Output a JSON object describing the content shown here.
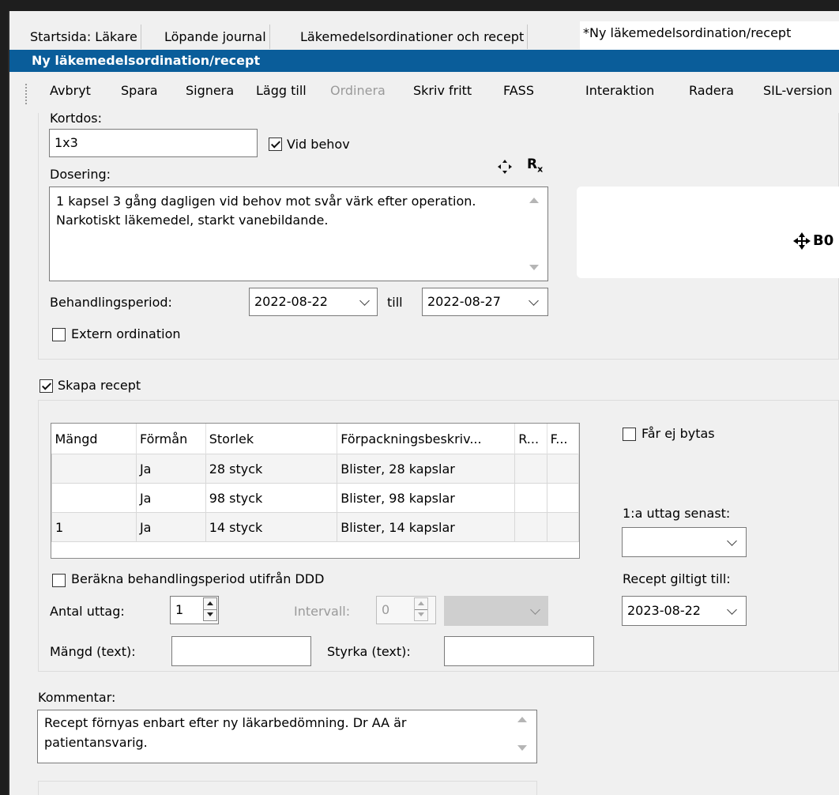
{
  "tabs": [
    {
      "label": "Startsida: Läkare"
    },
    {
      "label": "Löpande journal"
    },
    {
      "label": "Läkemedelsordinationer och recept"
    },
    {
      "label": "*Ny läkemedelsordination/recept"
    }
  ],
  "window_title": "Ny läkemedelsordination/recept",
  "toolbar": {
    "avbryt": "Avbryt",
    "spara": "Spara",
    "signera": "Signera",
    "lagg_till": "Lägg till",
    "ordinera": "Ordinera",
    "skriv_fritt": "Skriv fritt",
    "fass": "FASS",
    "interaktion": "Interaktion",
    "radera": "Radera",
    "sil_version": "SIL-version"
  },
  "kortdos": {
    "label": "Kortdos:",
    "value": "1x3"
  },
  "vid_behov": {
    "label": "Vid behov",
    "checked": true
  },
  "dosering": {
    "label": "Dosering:",
    "text": "1 kapsel 3 gång dagligen vid behov mot svår värk efter operation. Narkotiskt läkemedel, starkt vanebildande.",
    "move_icon": "move-arrows-icon",
    "rx_icon": "rx-icon"
  },
  "side_panel": {
    "text": "B0"
  },
  "behandlingsperiod": {
    "label": "Behandlingsperiod:",
    "from": "2022-08-22",
    "till_label": "till",
    "to": "2022-08-27"
  },
  "extern_ordination": {
    "label": "Extern ordination",
    "checked": false
  },
  "skapa_recept": {
    "label": "Skapa recept",
    "checked": true
  },
  "package_table": {
    "columns": [
      "Mängd",
      "Förmån",
      "Storlek",
      "Förpackningsbeskriv...",
      "R...",
      "F..."
    ],
    "rows": [
      {
        "mangd": "",
        "forman": "Ja",
        "storlek": "28 styck",
        "beskrivning": "Blister, 28 kapslar",
        "r": "",
        "f": ""
      },
      {
        "mangd": "",
        "forman": "Ja",
        "storlek": "98 styck",
        "beskrivning": "Blister, 98 kapslar",
        "r": "",
        "f": ""
      },
      {
        "mangd": "1",
        "forman": "Ja",
        "storlek": "14 styck",
        "beskrivning": "Blister, 14 kapslar",
        "r": "",
        "f": ""
      }
    ]
  },
  "far_ej_bytas": {
    "label": "Får ej bytas",
    "checked": false
  },
  "forsta_uttag": {
    "label": "1:a uttag senast:",
    "value": ""
  },
  "berakna": {
    "label": "Beräkna behandlingsperiod utifrån DDD",
    "checked": false
  },
  "antal_uttag": {
    "label": "Antal uttag:",
    "value": "1"
  },
  "intervall": {
    "label": "Intervall:",
    "value": "0"
  },
  "recept_giltigt": {
    "label": "Recept giltigt till:",
    "value": "2023-08-22"
  },
  "mangd_text": {
    "label": "Mängd (text):",
    "value": ""
  },
  "styrka_text": {
    "label": "Styrka (text):",
    "value": ""
  },
  "kommentar": {
    "label": "Kommentar:",
    "text": "Recept förnyas enbart efter ny läkarbedömning. Dr AA är patientansvarig."
  }
}
